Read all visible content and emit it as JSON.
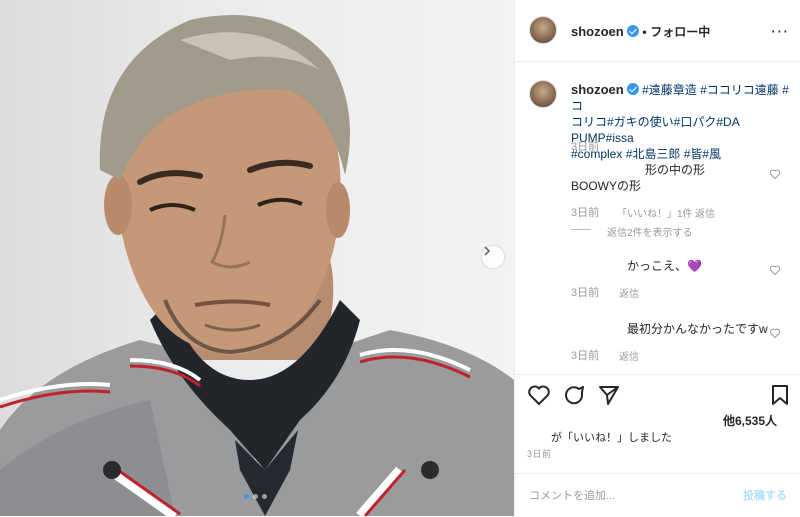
{
  "post": {
    "username": "shozoen",
    "follow_separator": "•",
    "follow_label": "フォロー中",
    "more_label": "···"
  },
  "caption": {
    "username": "shozoen",
    "hashtags": [
      "#遠藤章造",
      "#ココリコ遠藤",
      "#ココリコ",
      "#ガキの使い",
      "#口パク",
      "#DA PUMP",
      "#issa",
      "#complex",
      "#北島三郎",
      "#皆",
      "#風"
    ],
    "line1": "#遠藤章造 #ココリコ遠藤 #コ",
    "line2": "コリコ#ガキの使い#口パク#DA PUMP#issa",
    "line3": "#complex #北島三郎 #皆#風",
    "time": "3日前"
  },
  "comments": [
    {
      "text_line1": "形の中の形",
      "text_line2": "BOOWYの形",
      "time": "3日前",
      "likes": "「いいね！」1件",
      "reply_label": "返信",
      "view_replies": "返信2件を表示する",
      "reply_dash": "——"
    },
    {
      "text": "かっこえ、💜",
      "time": "3日前",
      "reply_label": "返信"
    },
    {
      "text": "最初分かんなかったですw",
      "time": "3日前",
      "reply_label": "返信"
    }
  ],
  "actions": {
    "likes_count": "他6,535人",
    "liked_text": "が「いいね！」しました",
    "posted_ago": "3日前"
  },
  "add_comment": {
    "placeholder": "コメントを追加...",
    "post_label": "投稿する"
  },
  "carousel": {
    "slides": 3,
    "active_index": 0
  },
  "colors": {
    "accent": "#3897f0",
    "link": "#003569",
    "muted": "#999999",
    "heart": "#8b5cf6"
  },
  "icons": [
    "verified-badge-icon",
    "more-icon",
    "heart-icon",
    "comment-icon",
    "share-icon",
    "bookmark-icon",
    "next-arrow-icon"
  ]
}
